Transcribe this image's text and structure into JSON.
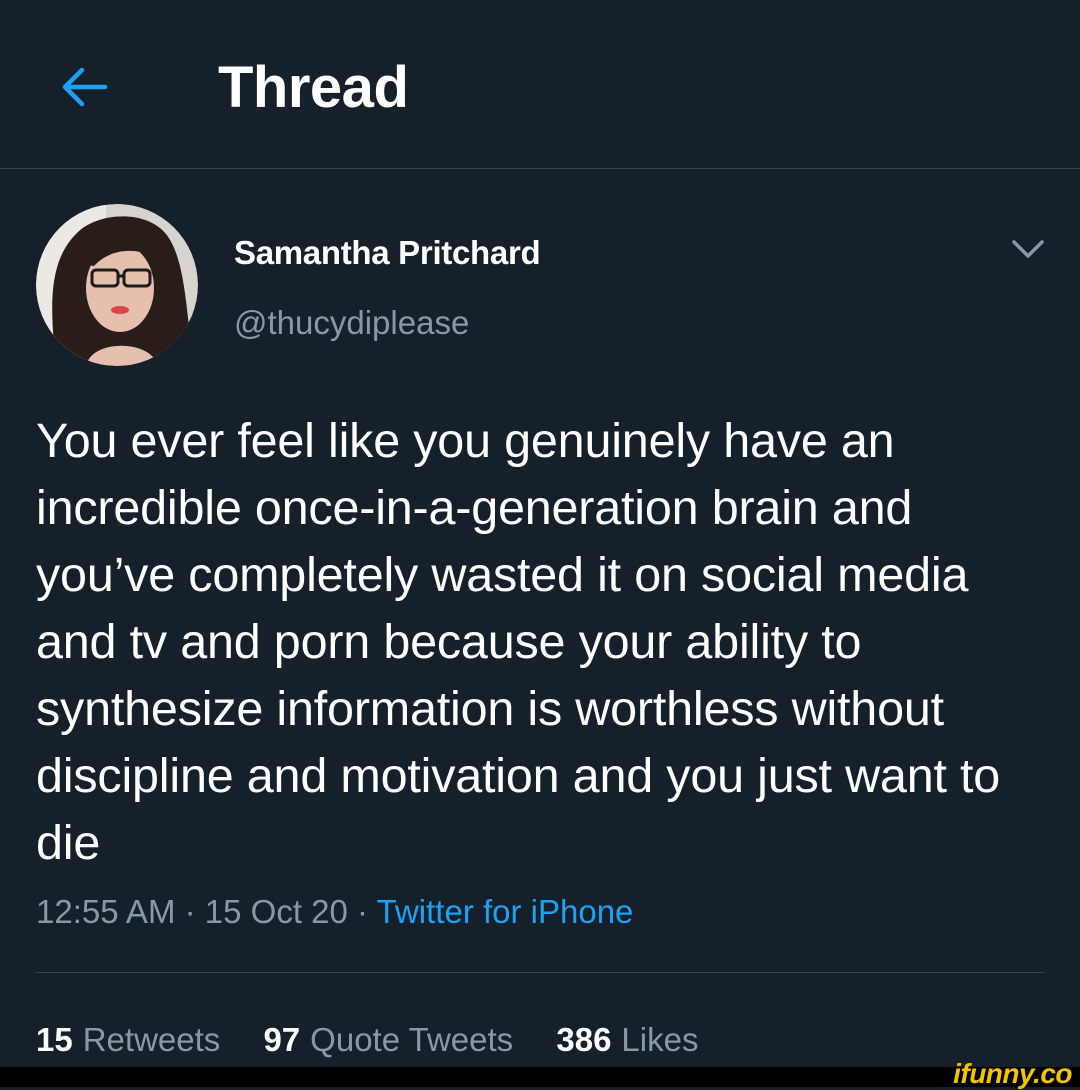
{
  "header": {
    "back_icon": "arrow-left-icon",
    "title": "Thread"
  },
  "tweet": {
    "author": {
      "name": "Samantha Pritchard",
      "handle": "@thucydiplease",
      "avatar_icon": "profile-photo"
    },
    "menu_icon": "chevron-down-icon",
    "text": "You ever feel like you genuinely have an incredible once-in-a-generation brain and you’ve completely wasted it on social media and tv and porn because your ability to synthesize information is worthless without discipline and motivation and you just want to die",
    "time": "12:55 AM",
    "date": "15 Oct 20",
    "separator": "·",
    "source": "Twitter for iPhone"
  },
  "stats": {
    "retweets": {
      "count": "15",
      "label": "Retweets"
    },
    "quote_tweets": {
      "count": "97",
      "label": "Quote Tweets"
    },
    "likes": {
      "count": "386",
      "label": "Likes"
    }
  },
  "watermark": "ifunny.co",
  "colors": {
    "background": "#15202b",
    "accent": "#1da1f2",
    "secondary_text": "#8899a6",
    "divider": "#38444d"
  }
}
